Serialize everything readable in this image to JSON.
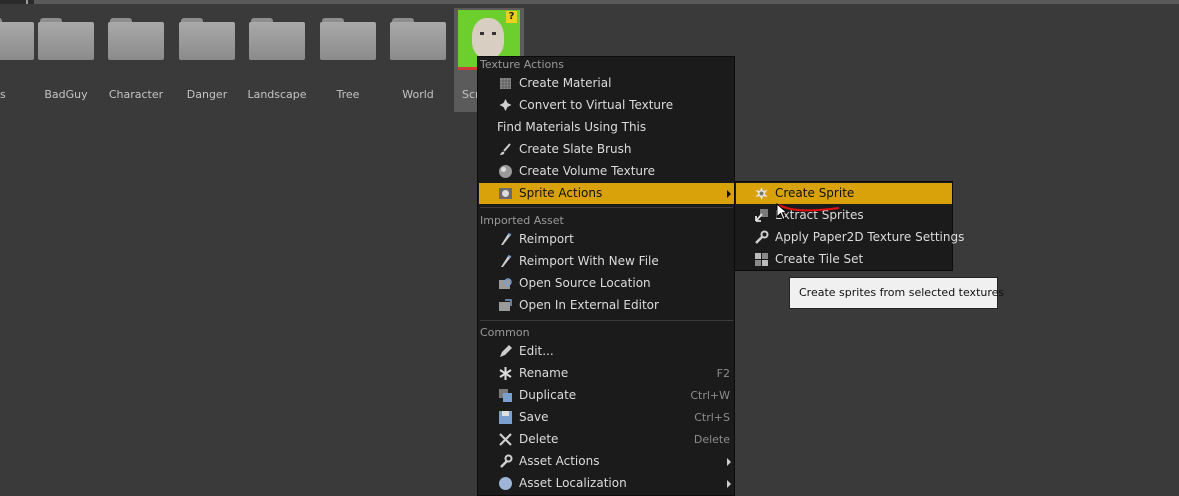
{
  "folders": [
    {
      "label": "ies"
    },
    {
      "label": "BadGuy"
    },
    {
      "label": "Character"
    },
    {
      "label": "Danger"
    },
    {
      "label": "Landscape"
    },
    {
      "label": "Tree"
    },
    {
      "label": "World"
    }
  ],
  "selected_asset": {
    "label": "Scr"
  },
  "context_menu": {
    "texture_actions_header": "Texture Actions",
    "create_material": "Create Material",
    "convert_virtual": "Convert to Virtual Texture",
    "find_materials": "Find Materials Using This",
    "create_slate_brush": "Create Slate Brush",
    "create_volume_texture": "Create Volume Texture",
    "sprite_actions": "Sprite Actions",
    "imported_asset_header": "Imported Asset",
    "reimport": "Reimport",
    "reimport_new_file": "Reimport With New File",
    "open_source_location": "Open Source Location",
    "open_external_editor": "Open In External Editor",
    "common_header": "Common",
    "edit": "Edit...",
    "rename": "Rename",
    "rename_shortcut": "F2",
    "duplicate": "Duplicate",
    "duplicate_shortcut": "Ctrl+W",
    "save": "Save",
    "save_shortcut": "Ctrl+S",
    "delete": "Delete",
    "delete_shortcut": "Delete",
    "asset_actions": "Asset Actions",
    "asset_localization": "Asset Localization"
  },
  "sprite_submenu": {
    "create_sprite": "Create Sprite",
    "extract_sprites": "Extract Sprites",
    "apply_paper2d": "Apply Paper2D Texture Settings",
    "create_tile_set": "Create Tile Set"
  },
  "tooltip": {
    "text": "Create sprites from selected textures"
  },
  "colors": {
    "background": "#3a3a3a",
    "menu_bg": "#1b1b1b",
    "highlight": "#d9a20a",
    "tooltip_bg": "#f0f0f0",
    "annotation_red": "#e01010"
  }
}
